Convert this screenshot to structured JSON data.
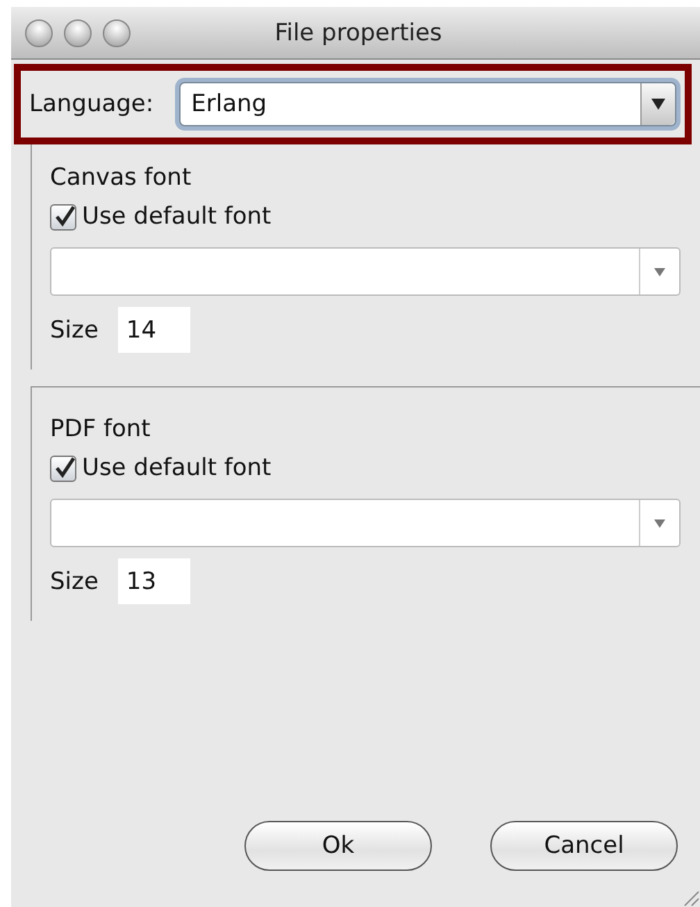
{
  "window": {
    "title": "File properties"
  },
  "language": {
    "label": "Language:",
    "value": "Erlang"
  },
  "sections": [
    {
      "title": "Canvas font",
      "checkbox": {
        "label": "Use default font",
        "checked": true
      },
      "size_label": "Size",
      "size_value": "14"
    },
    {
      "title": "PDF font",
      "checkbox": {
        "label": "Use default font",
        "checked": true
      },
      "size_label": "Size",
      "size_value": "13"
    }
  ],
  "buttons": [
    "Ok",
    "Cancel"
  ]
}
